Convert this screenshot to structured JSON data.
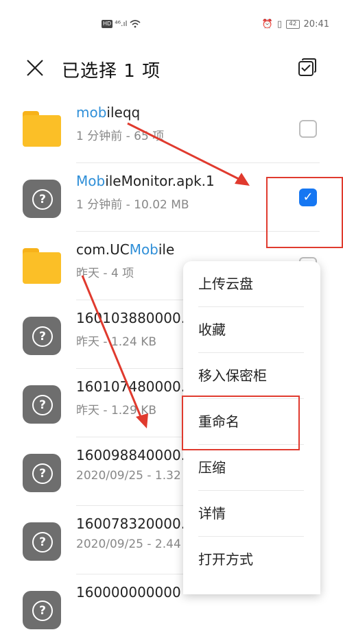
{
  "status_bar": {
    "network": "⁴⁶.ıl",
    "hd_label": "HD",
    "alarm": "⏰",
    "vibrate": "▯",
    "battery": "42",
    "time": "20:41"
  },
  "header": {
    "title": "已选择 1 项"
  },
  "files": [
    {
      "name_pre": "mob",
      "name_hl": "",
      "name_post": "ileqq",
      "name_hl_first": true,
      "hl": "mob",
      "meta": "1 分钟前 - 65 项",
      "kind": "folder",
      "checked": false
    },
    {
      "hl": "Mob",
      "name_post": "ileMonitor.apk.1",
      "meta": "1 分钟前 - 10.02 MB",
      "kind": "unknown",
      "checked": true
    },
    {
      "name_pre": "com.UC",
      "hl": "Mob",
      "name_post": "ile",
      "meta": "昨天 - 4 项",
      "kind": "folder",
      "checked": false
    },
    {
      "name": "160103880000..",
      "meta": "昨天 - 1.24 KB",
      "kind": "unknown"
    },
    {
      "name": "160107480000..",
      "meta": "昨天 - 1.29 KB",
      "kind": "unknown"
    },
    {
      "name": "160098840000..",
      "meta": "2020/09/25 - 1.32",
      "kind": "unknown"
    },
    {
      "name": "160078320000..",
      "meta": "2020/09/25 - 2.44",
      "kind": "unknown"
    },
    {
      "name": "160000000000",
      "kind": "unknown"
    }
  ],
  "menu": {
    "items": [
      "上传云盘",
      "收藏",
      "移入保密柜",
      "重命名",
      "压缩",
      "详情",
      "打开方式"
    ]
  },
  "colors": {
    "accent": "#1677F2",
    "highlight": "#2F8FD8",
    "annotation": "#E03A2E",
    "folder": "#FBBF27"
  }
}
